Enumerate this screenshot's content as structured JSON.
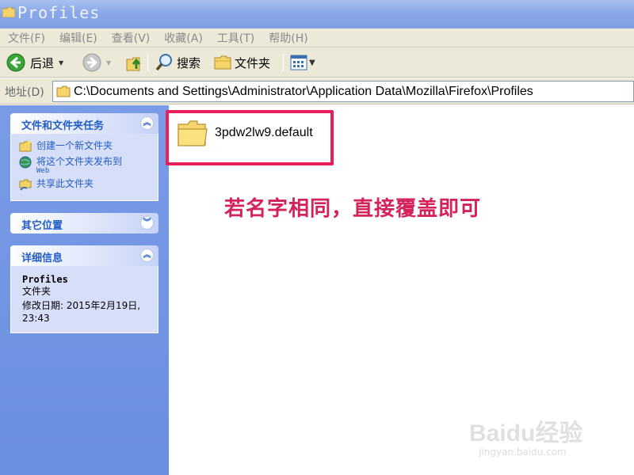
{
  "window": {
    "title": "Profiles"
  },
  "menu": [
    "文件(F)",
    "编辑(E)",
    "查看(V)",
    "收藏(A)",
    "工具(T)",
    "帮助(H)"
  ],
  "toolbar": {
    "back": "后退",
    "search": "搜索",
    "folders": "文件夹"
  },
  "address": {
    "label": "地址(D)",
    "path": "C:\\Documents and Settings\\Administrator\\Application Data\\Mozilla\\Firefox\\Profiles"
  },
  "tasks_panel": {
    "title": "文件和文件夹任务",
    "items": [
      {
        "label": "创建一个新文件夹",
        "sub": ""
      },
      {
        "label": "将这个文件夹发布到",
        "sub": "Web"
      },
      {
        "label": "共享此文件夹",
        "sub": ""
      }
    ]
  },
  "other_panel": {
    "title": "其它位置"
  },
  "details_panel": {
    "title": "详细信息",
    "name": "Profiles",
    "type": "文件夹",
    "modified_line1": "修改日期: 2015年2月19日,",
    "modified_line2": "23:43"
  },
  "main": {
    "folder_name": "3pdw2lw9.default",
    "annotation": "若名字相同，直接覆盖即可"
  },
  "watermark": {
    "logo": "Baidu经验",
    "url": "jingyan.baidu.com"
  },
  "colors": {
    "highlight": "#e8205a",
    "annotation": "#d4235a",
    "task_link": "#215dc6"
  }
}
